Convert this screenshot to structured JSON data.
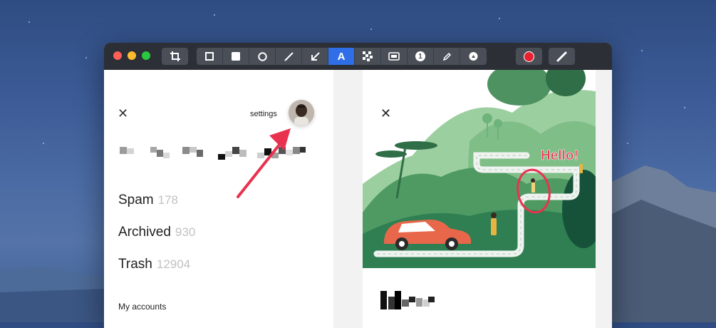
{
  "toolbar": {
    "tools": [
      "crop-icon",
      "square-outline-icon",
      "square-filled-icon",
      "circle-icon",
      "line-icon",
      "arrow-icon",
      "text-icon",
      "pixelate-icon",
      "highlight-box-icon",
      "number-icon",
      "pencil-icon",
      "stamp-icon"
    ],
    "active_tool": "text-icon",
    "text_tool_label": "A",
    "number_tool_label": "1",
    "color_swatch": "#e8202f",
    "accent": "#2f6ee6"
  },
  "left_panel": {
    "settings_label": "settings",
    "menu": [
      {
        "label": "Spam",
        "count": "178"
      },
      {
        "label": "Archived",
        "count": "930"
      },
      {
        "label": "Trash",
        "count": "12904"
      }
    ],
    "section_title": "My accounts"
  },
  "right_panel": {
    "annotation_text": "Hello!"
  }
}
